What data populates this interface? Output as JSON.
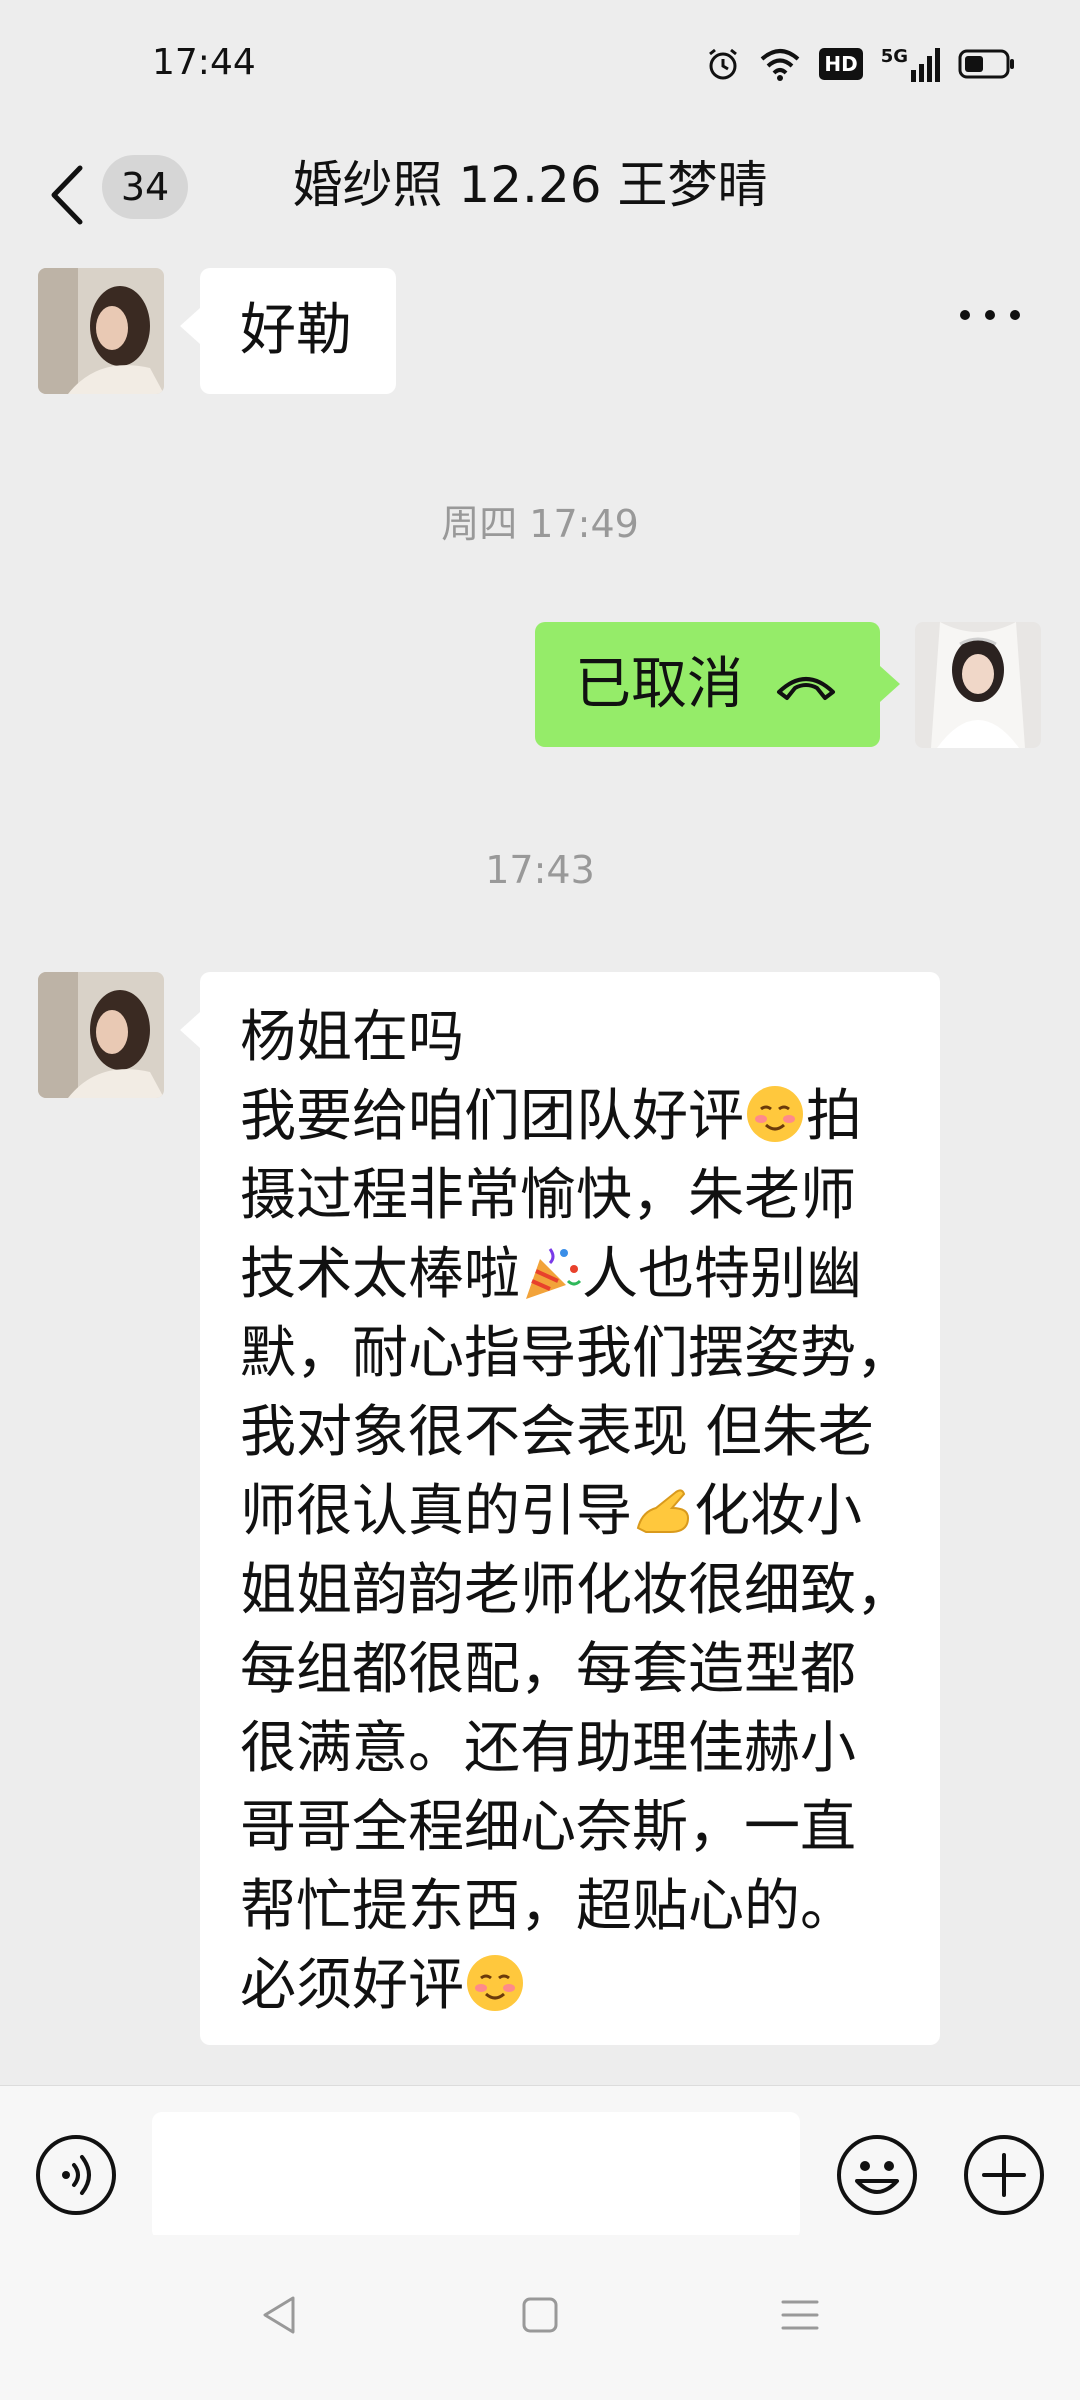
{
  "status_bar": {
    "time": "17:44",
    "icons": [
      "alarm-icon",
      "wifi-icon",
      "hd-icon",
      "5g-signal-icon",
      "battery-icon"
    ],
    "hd_label": "HD",
    "network_label": "5G"
  },
  "header": {
    "unread_count": "34",
    "title": "婚纱照 12.26  王梦晴"
  },
  "messages": {
    "m1_text": "好勒",
    "ts1": "周四 17:49",
    "m2_text": "已取消",
    "ts2": "17:43",
    "m3_l1": "杨姐在吗",
    "m3_l2a": "我要给咱们团队好评",
    "m3_l2b": "拍",
    "m3_l3": "摄过程非常愉快，朱老师",
    "m3_l4a": "技术太棒啦",
    "m3_l4b": "人也特别幽",
    "m3_l5": "默，耐心指导我们摆姿势，",
    "m3_l6": "我对象很不会表现 但朱老",
    "m3_l7a": "师很认真的引导",
    "m3_l7b": "化妆小",
    "m3_l8": "姐姐韵韵老师化妆很细致，",
    "m3_l9": "每组都很配，每套造型都",
    "m3_l10": "很满意。还有助理佳赫小",
    "m3_l11": "哥哥全程细心奈斯，一直",
    "m3_l12": "帮忙提东西，超贴心的。",
    "m3_l13": "必须好评"
  },
  "colors": {
    "background": "#ededed",
    "sent_bubble": "#95ec69",
    "received_bubble": "#ffffff",
    "timestamp": "#999999"
  }
}
